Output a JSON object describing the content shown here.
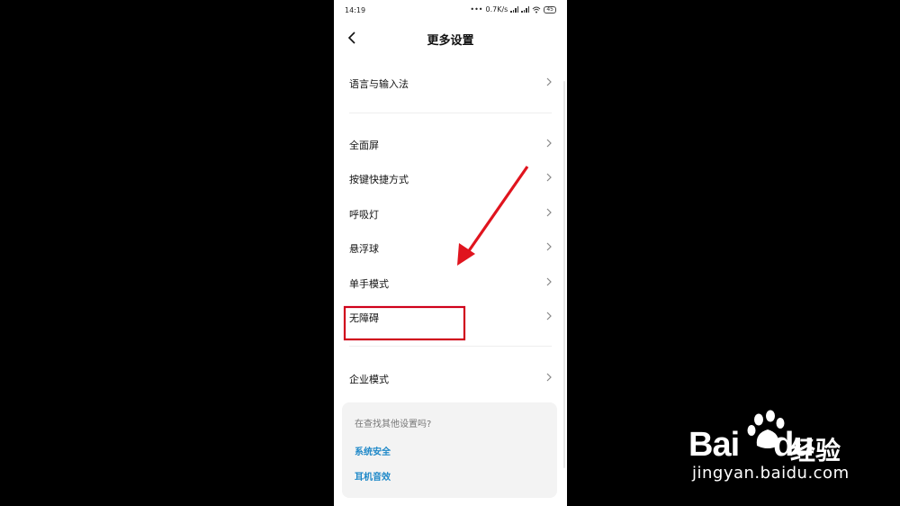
{
  "status_bar": {
    "time": "14:19",
    "network_speed": "0.7K/s",
    "battery": "45"
  },
  "header": {
    "title": "更多设置",
    "back_icon": "chevron-left-icon"
  },
  "menu": {
    "items": [
      {
        "label": "语言与输入法"
      },
      {
        "label": "全面屏"
      },
      {
        "label": "按键快捷方式"
      },
      {
        "label": "呼吸灯"
      },
      {
        "label": "悬浮球"
      },
      {
        "label": "单手模式"
      },
      {
        "label": "无障碍"
      },
      {
        "label": "企业模式"
      }
    ]
  },
  "suggestions": {
    "title": "在查找其他设置吗?",
    "links": [
      {
        "label": "系统安全"
      },
      {
        "label": "耳机音效"
      }
    ]
  },
  "watermark": {
    "brand_latin": "Bai",
    "brand_latin_end": "du",
    "brand_cn": "经验",
    "url": "jingyan.baidu.com"
  },
  "colors": {
    "highlight_box": "#d0021b",
    "arrow": "#e0141e",
    "link": "#1e88c8"
  }
}
